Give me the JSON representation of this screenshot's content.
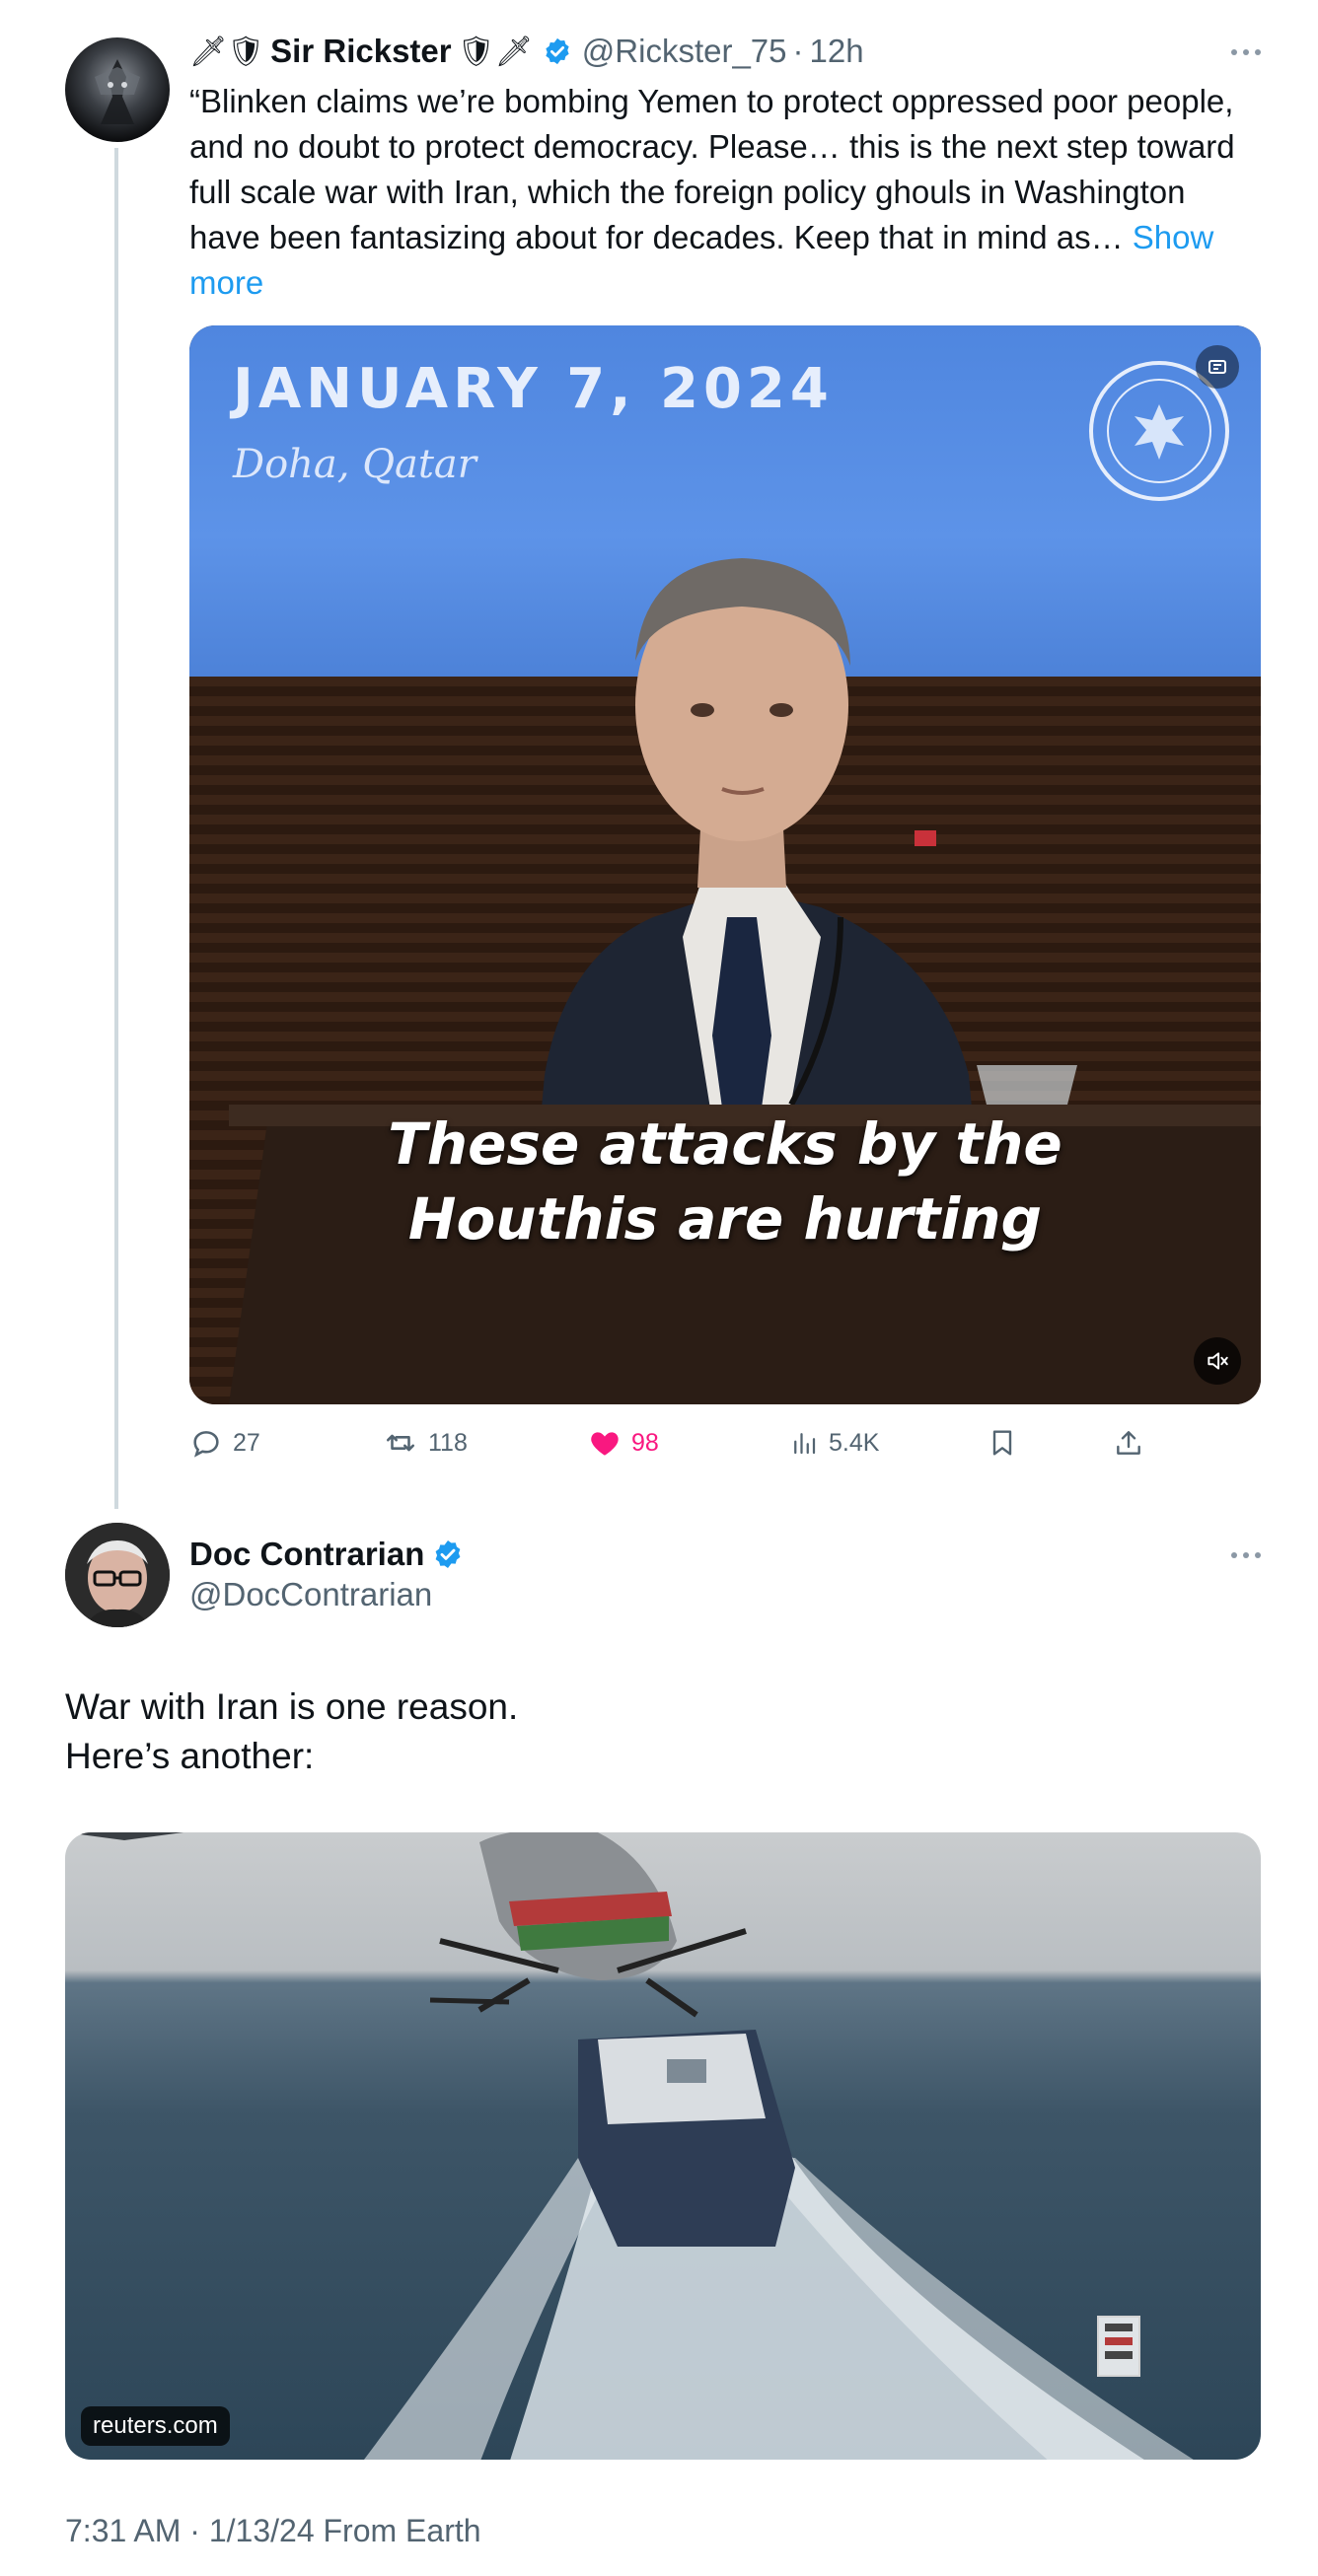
{
  "tweet1": {
    "emoji_prefix": "🗡🛡",
    "display_name": "Sir Rickster",
    "emoji_suffix": "🛡🗡",
    "handle": "@Rickster_75",
    "separator": "·",
    "time": "12h",
    "text": "“Blinken claims we’re bombing Yemen to protect oppressed poor people, and no doubt to protect democracy. Please… this is the next step toward full scale war with Iran, which the foreign policy ghouls in Washington have been fantasizing about for decades. Keep that in mind as…",
    "show_more": "Show more",
    "media": {
      "date": "JANUARY 7, 2024",
      "location": "Doha, Qatar",
      "caption_line1": "These attacks by the",
      "caption_line2": "Houthis are hurting"
    },
    "stats": {
      "replies": "27",
      "reposts": "118",
      "likes": "98",
      "views": "5.4K"
    }
  },
  "tweet2": {
    "display_name": "Doc Contrarian",
    "handle": "@DocContrarian",
    "text_line1": "War with Iran is one reason.",
    "text_line2": "Here’s another:",
    "media": {
      "source_badge": "reuters.com"
    },
    "timestamp": "7:31 AM · 1/13/24 From Earth"
  },
  "colors": {
    "accent": "#1d9bf0",
    "like": "#f91880",
    "muted": "#536471"
  }
}
